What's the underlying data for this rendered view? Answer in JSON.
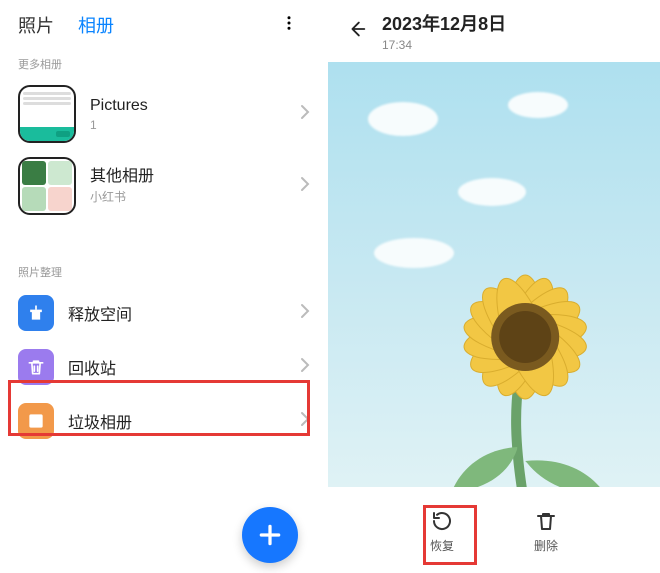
{
  "tabs": {
    "photos": "照片",
    "albums": "相册"
  },
  "sections": {
    "more_albums": "更多相册",
    "manage": "照片整理"
  },
  "albums": {
    "pictures": {
      "title": "Pictures",
      "count": "1"
    },
    "others": {
      "title": "其他相册",
      "sub": "小红书"
    }
  },
  "manage": {
    "free_space": "释放空间",
    "recycle_bin": "回收站",
    "junk_album": "垃圾相册"
  },
  "preview": {
    "date": "2023年12月8日",
    "time": "17:34",
    "actions": {
      "restore": "恢复",
      "delete": "删除"
    }
  }
}
